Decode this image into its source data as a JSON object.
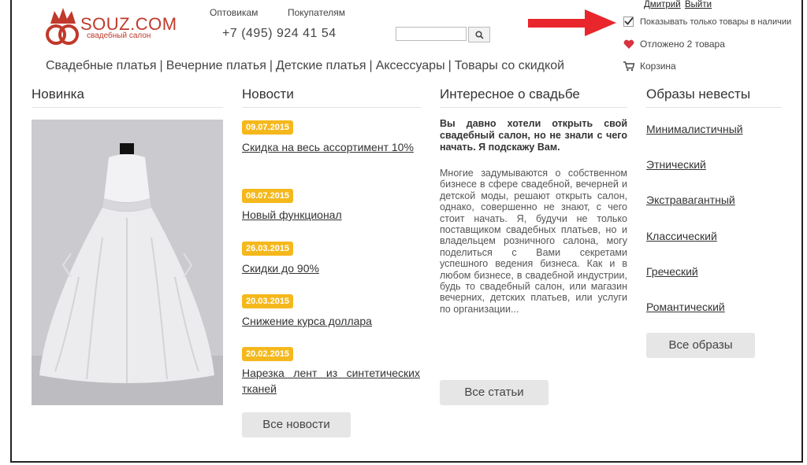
{
  "header": {
    "logo_text": "SOUZ.COM",
    "logo_sub": "свадебный салон",
    "link_wholesale": "Оптовикам",
    "link_buyers": "Покупателям",
    "phone": "+7 (495) 924 41 54",
    "search_placeholder": "",
    "user_name": "Дмитрий",
    "logout": "Выйти",
    "in_stock_label": "Показывать только товары в наличии",
    "deferred_label": "Отложено 2 товара",
    "cart_label": "Корзина"
  },
  "nav": {
    "items": [
      "Свадебные платья",
      "Вечерние платья",
      "Детские платья",
      "Аксессуары",
      "Товары со скидкой"
    ],
    "separator": "|"
  },
  "novelty": {
    "title": "Новинка"
  },
  "news": {
    "title": "Новости",
    "items": [
      {
        "date": "09.07.2015",
        "title": "Скидка на весь ассортимент 10%"
      },
      {
        "date": "08.07.2015",
        "title": "Новый функционал"
      },
      {
        "date": "26.03.2015",
        "title": "Скидки до 90%"
      },
      {
        "date": "20.03.2015",
        "title": "Снижение курса доллара"
      },
      {
        "date": "20.02.2015",
        "title": "Нарезка лент из синтетических тканей"
      }
    ],
    "all_button": "Все новости"
  },
  "interesting": {
    "title": "Интересное о свадьбе",
    "lead": "Вы давно хотели открыть свой свадебный салон, но не знали с чего начать. Я подскажу Вам.",
    "body": "Многие задумываются о собственном бизнесе в сфере свадебной, вечерней и детской моды, решают открыть салон, однако, совершенно не знают, с чего стоит начать. Я, будучи не только поставщиком свадебных платьев, но и владельцем розничного салона, могу поделиться с Вами секретами успешного ведения бизнеса. Как и в любом бизнесе, в свадебной индустрии, будь то свадебный салон, или магазин вечерних, детских платьев, или услуги по организации...",
    "all_button": "Все статьи"
  },
  "looks": {
    "title": "Образы невесты",
    "items": [
      "Минималистичный",
      "Этнический",
      "Экстравагантный",
      "Классический",
      "Греческий",
      "Романтический"
    ],
    "all_button": "Все образы"
  },
  "colors": {
    "accent": "#c0392b",
    "badge": "#f5b81c",
    "arrow": "#e8262b",
    "heart": "#d9333f"
  },
  "icons": {
    "search": "search-icon",
    "heart": "heart-icon",
    "cart": "cart-icon",
    "checkbox": "checkbox-icon",
    "arrow": "arrow-right-icon"
  }
}
